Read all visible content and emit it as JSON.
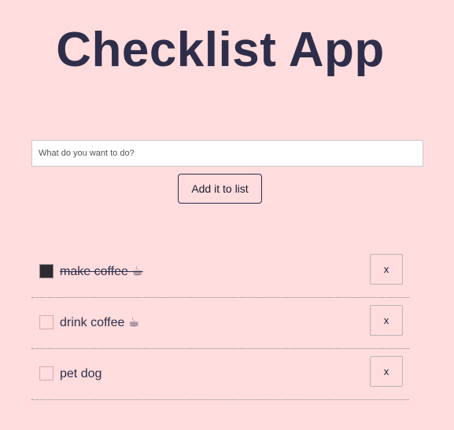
{
  "app": {
    "title": "Checklist App"
  },
  "form": {
    "input_value": "",
    "placeholder": "What do you want to do?",
    "add_label": "Add it to list"
  },
  "todos": [
    {
      "text": "make coffee ☕",
      "completed": true,
      "delete_label": "x"
    },
    {
      "text": "drink coffee ☕",
      "completed": false,
      "delete_label": "x"
    },
    {
      "text": "pet dog",
      "completed": false,
      "delete_label": "x"
    }
  ],
  "colors": {
    "background": "#ffdcdd",
    "text": "#2f2e4a",
    "checked_box": "#2e2b30"
  }
}
